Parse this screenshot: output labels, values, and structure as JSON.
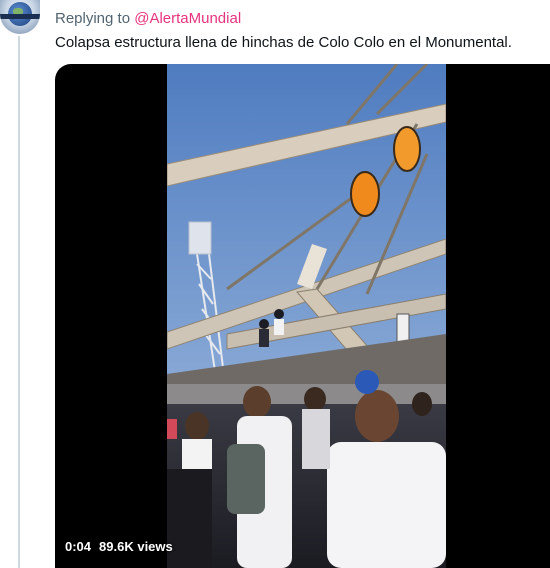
{
  "avatar": {
    "icon": "globe-logo-icon"
  },
  "reply": {
    "prefix": "Replying to",
    "mention": "@AlertaMundial"
  },
  "tweet": {
    "text": "Colapsa estructura llena de hinchas de Colo Colo en el Monumental."
  },
  "video": {
    "time": "0:04",
    "views": "89.6K views"
  },
  "colors": {
    "mention": "#e8337f",
    "secondary_text": "#536471",
    "sky": "#5d86c4",
    "structure": "#d9cdbd"
  }
}
